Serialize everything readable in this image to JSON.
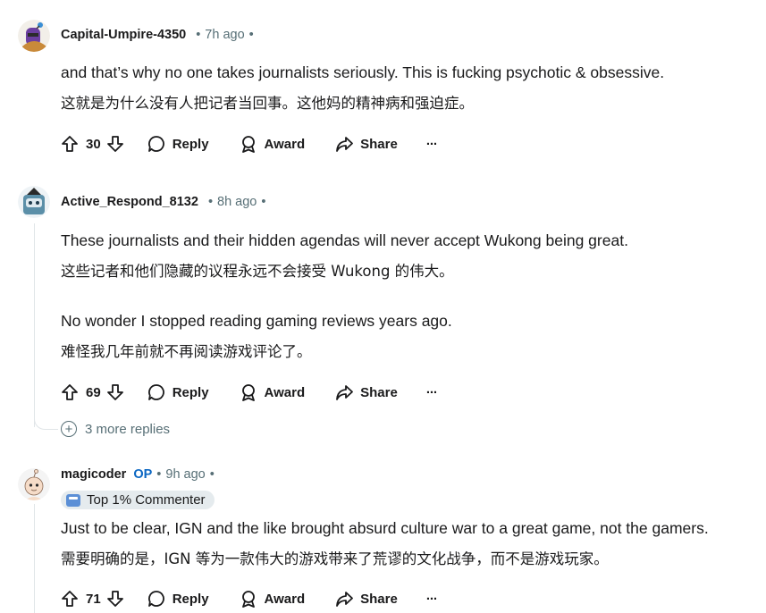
{
  "comments": [
    {
      "author": "Capital-Umpire-4350",
      "op_badge": "",
      "time": "7h ago",
      "text_en": "and that’s why no one takes journalists seriously. This is fucking psychotic & obsessive.",
      "text_zh": "这就是为什么没有人把记者当回事。这他妈的精神病和强迫症。",
      "votes": "30",
      "reply_label": "Reply",
      "award_label": "Award",
      "share_label": "Share",
      "more_label": "···"
    },
    {
      "author": "Active_Respond_8132",
      "op_badge": "",
      "time": "8h ago",
      "text_en": "These journalists and their hidden agendas will never accept Wukong being great.",
      "text_zh": "这些记者和他们隐藏的议程永远不会接受 Wukong 的伟大。",
      "text2_en": "No wonder I stopped reading gaming reviews years ago.",
      "text2_zh": "难怪我几年前就不再阅读游戏评论了。",
      "votes": "69",
      "reply_label": "Reply",
      "award_label": "Award",
      "share_label": "Share",
      "more_label": "···",
      "more_replies": "3 more replies"
    },
    {
      "author": "magicoder",
      "op_badge": "OP",
      "time": "9h ago",
      "flair": "Top 1% Commenter",
      "text_en": "Just to be clear, IGN and the like brought absurd culture war to a great game, not the gamers.",
      "text_zh": "需要明确的是，IGN 等为一款伟大的游戏带来了荒谬的文化战争，而不是游戏玩家。",
      "votes": "71",
      "reply_label": "Reply",
      "award_label": "Award",
      "share_label": "Share",
      "more_label": "···"
    }
  ],
  "colors": {
    "meta": "#576f76",
    "op": "#0a66c2",
    "thread": "#e0e5e8"
  },
  "icons": [
    "upvote-icon",
    "downvote-icon",
    "reply-bubble-icon",
    "award-icon",
    "share-icon",
    "more-icon",
    "expand-plus-icon"
  ]
}
